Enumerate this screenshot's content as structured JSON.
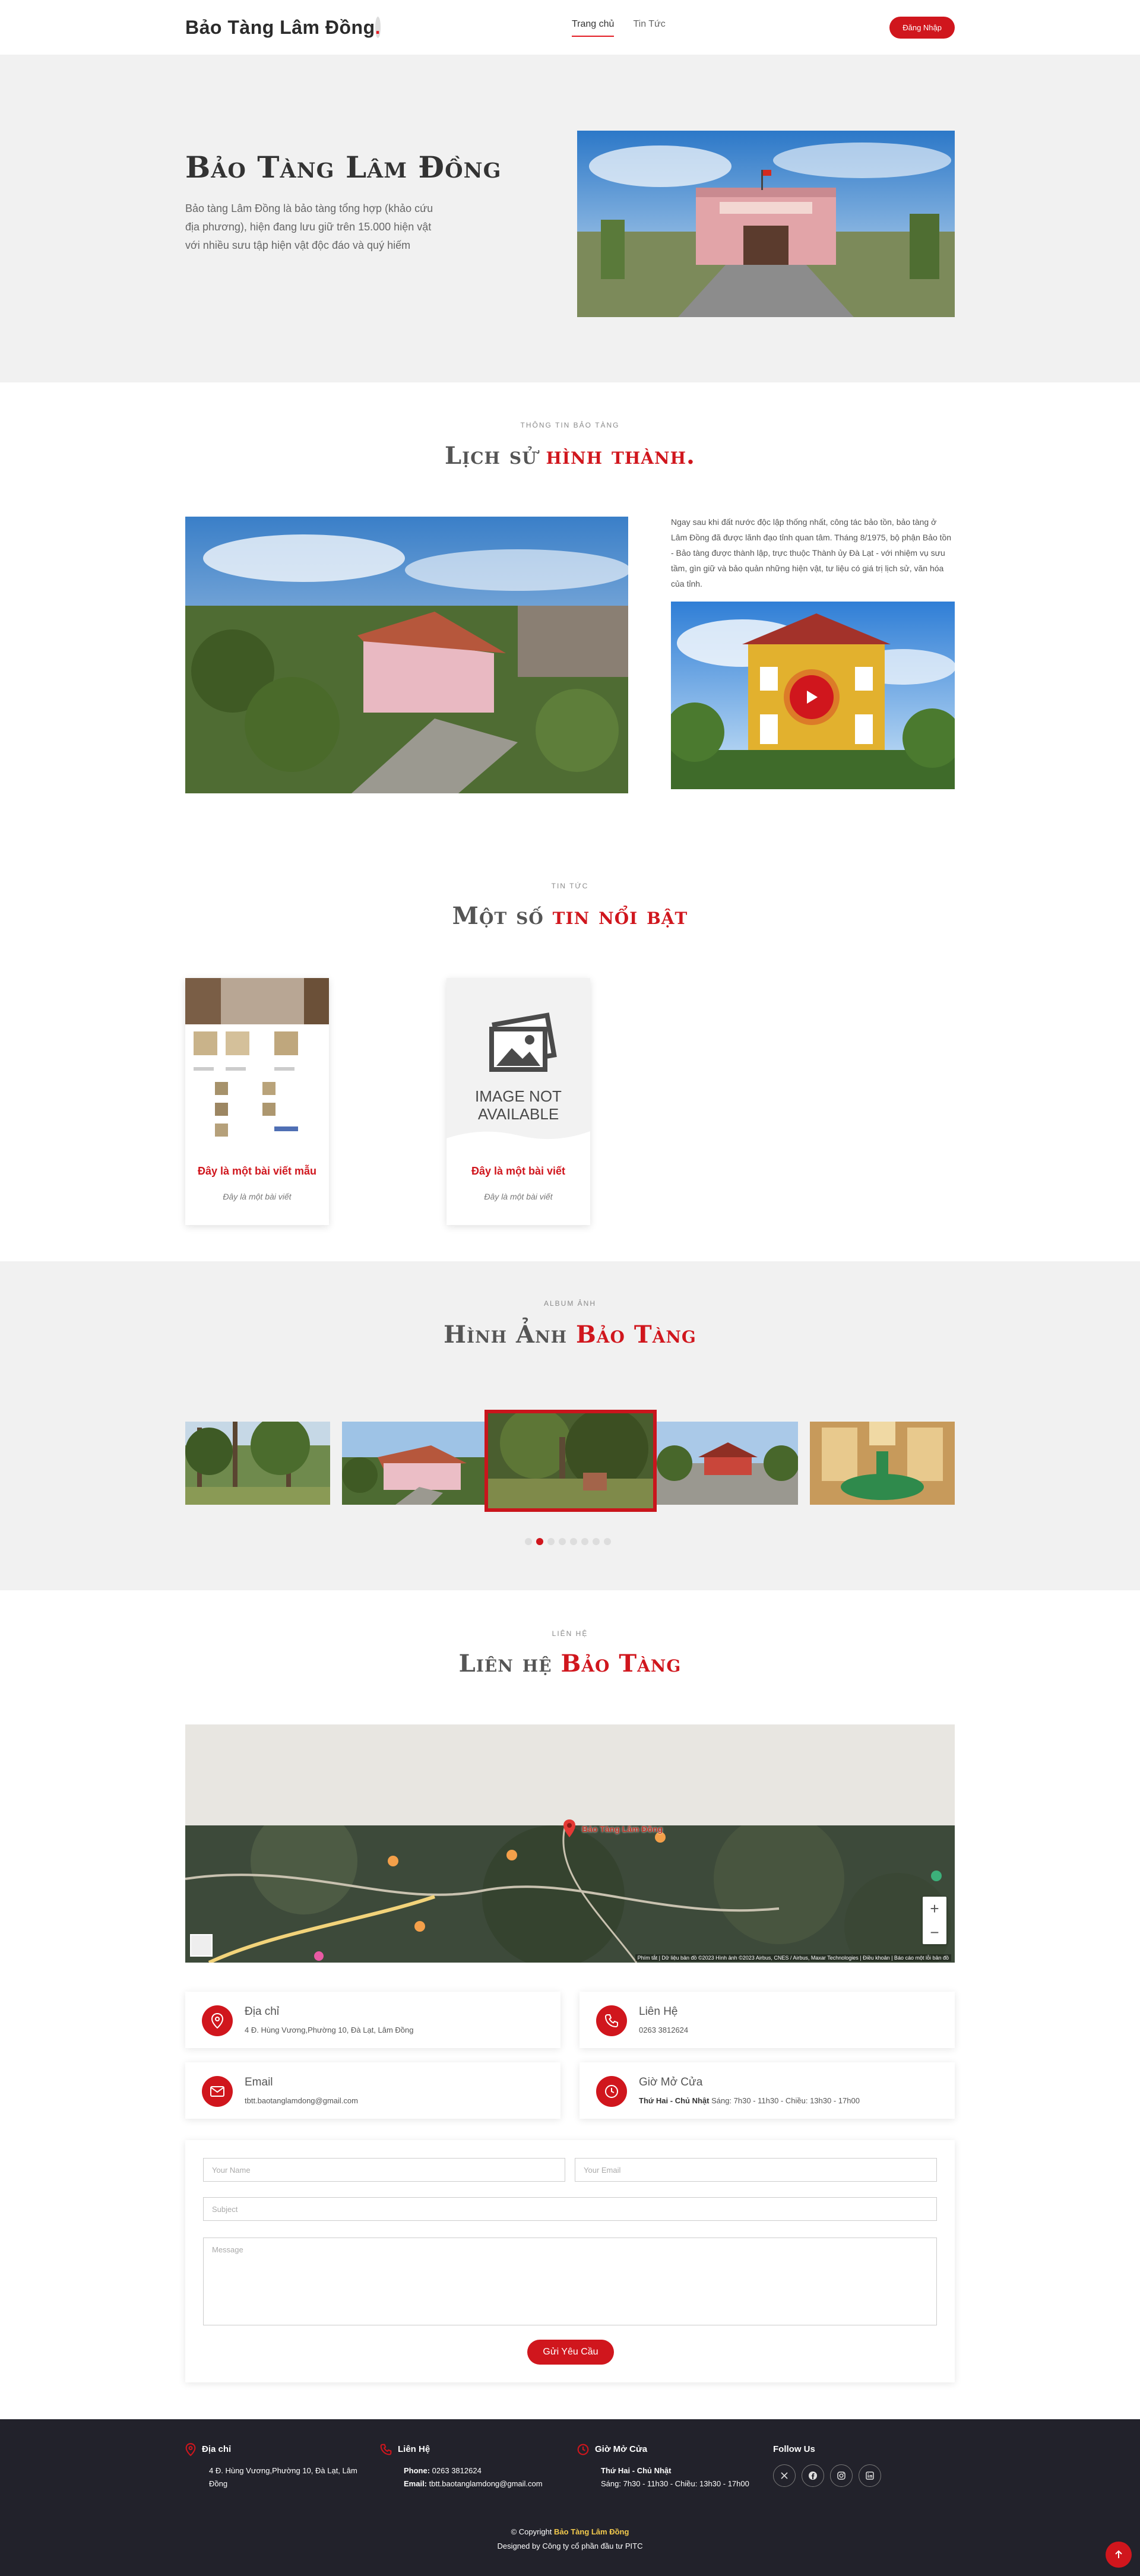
{
  "header": {
    "logo": "Bảo Tàng Lâm Đồng",
    "logo_dot": ".",
    "nav": [
      {
        "label": "Trang chủ"
      },
      {
        "label": "Tin Tức"
      }
    ],
    "login_label": "Đăng Nhập"
  },
  "hero": {
    "title": "Bảo Tàng Lâm Đồng",
    "description": "Bảo tàng Lâm Đồng là bảo tàng tổng hợp (khảo cứu địa phương), hiện đang lưu giữ trên 15.000 hiện vật với nhiều sưu tập hiện vật độc đáo và quý hiếm"
  },
  "history": {
    "label": "Thông tin bảo tàng",
    "title_a": "Lịch sử ",
    "title_b": "hình thành.",
    "text": "Ngay sau khi đất nước độc lập thống nhất, công tác bảo tồn, bảo tàng ở Lâm Đồng đã được lãnh đạo tỉnh quan tâm. Tháng 8/1975, bộ phận Bảo tồn - Bảo tàng được thành lập, trực thuộc Thành ủy Đà Lạt - với nhiệm vụ sưu tầm, gìn giữ và bảo quản những hiện vật, tư liệu có giá trị lịch sử, văn hóa của tỉnh."
  },
  "news": {
    "label": "Tin tức",
    "title_a": "Một số ",
    "title_b": "tin nổi bật",
    "cards": [
      {
        "title": "Đây là một bài viết mẫu",
        "excerpt": "Đây là một bài viết"
      },
      {
        "title": "Đây là một bài viết",
        "excerpt": "Đây là một bài viết"
      }
    ],
    "placeholder_line1": "IMAGE NOT",
    "placeholder_line2": "AVAILABLE"
  },
  "album": {
    "label": "Album ảnh",
    "title_a": "Hình Ảnh ",
    "title_b": "Bảo Tàng",
    "dots_total": 8,
    "active_dot": 2
  },
  "contact": {
    "label": "Liên hệ",
    "title_a": "Liên hệ ",
    "title_b": "Bảo Tàng",
    "map_pin_label": "Bảo Tàng Lâm Đồng",
    "map_credit": "Phím tắt | Dữ liệu bản đồ ©2023 Hình ảnh ©2023 Airbus, CNES / Airbus, Maxar Technologies | Điều khoản | Báo cáo một lỗi bản đồ",
    "address_title": "Địa chỉ",
    "address_text": "4 Đ. Hùng Vương,Phường 10, Đà Lạt, Lâm Đồng",
    "phone_title": "Liên Hệ",
    "phone_text": "0263 3812624",
    "email_title": "Email",
    "email_text": "tbtt.baotanglamdong@gmail.com",
    "hours_title": "Giờ Mở Cửa",
    "hours_days": "Thứ Hai - Chủ Nhật",
    "hours_text": " Sáng: 7h30 - 11h30 - Chiều: 13h30 - 17h00",
    "form": {
      "name_placeholder": "Your Name",
      "email_placeholder": "Your Email",
      "subject_placeholder": "Subject",
      "message_placeholder": "Message",
      "submit_label": "Gửi Yêu Cầu"
    }
  },
  "footer": {
    "address_title": "Địa chỉ",
    "address_text": "4 Đ. Hùng Vương,Phường 10, Đà Lạt, Lâm Đồng",
    "phone_title": "Liên Hệ",
    "phone_label": "Phone:",
    "phone_text": " 0263 3812624",
    "email_label": "Email:",
    "email_text": " tbtt.baotanglamdong@gmail.com",
    "hours_title": "Giờ Mở Cửa",
    "hours_days": "Thứ Hai - Chủ Nhật",
    "hours_text": "Sáng: 7h30 - 11h30 - Chiều: 13h30 - 17h00",
    "follow_title": "Follow Us",
    "copyright_prefix": "© Copyright ",
    "copyright_brand": "Bảo Tàng Lâm Đồng",
    "designed_by": "Designed by Công ty cổ phần đầu tư PITC"
  },
  "colors": {
    "accent": "#d0161d",
    "footer_bg": "#22222b",
    "hero_bg": "#f1f1f1"
  }
}
